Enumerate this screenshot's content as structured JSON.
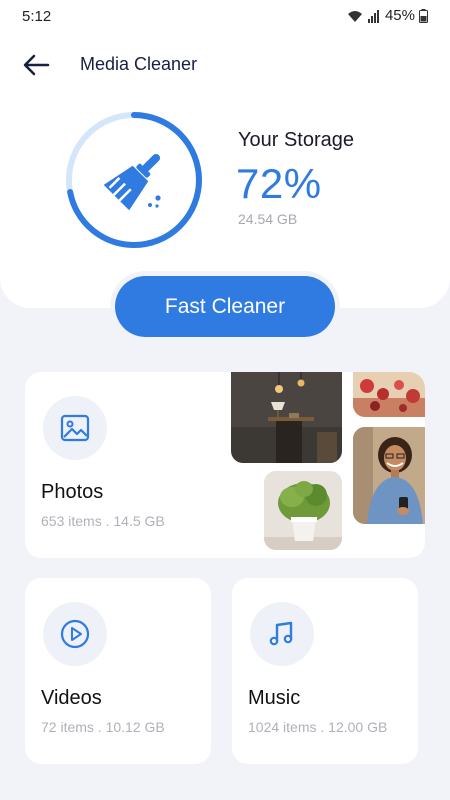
{
  "status_bar": {
    "time": "5:12",
    "battery": "45%",
    "icons": [
      "wifi-icon",
      "signal-icon",
      "battery-icon"
    ]
  },
  "header": {
    "title": "Media Cleaner",
    "back_icon": "arrow-left-icon"
  },
  "storage": {
    "label": "Your Storage",
    "percent_text": "72%",
    "percent_value": 72,
    "size": "24.54 GB",
    "icon": "broom-icon"
  },
  "fast_cleaner": {
    "label": "Fast Cleaner"
  },
  "photos": {
    "title": "Photos",
    "subtitle": "653 items . 14.5 GB",
    "icon": "image-icon",
    "thumbnails": [
      "interior-lamp-photo",
      "flowers-photo",
      "plant-pot-photo",
      "woman-portrait-photo"
    ]
  },
  "videos": {
    "title": "Videos",
    "subtitle": "72 items . 10.12 GB",
    "icon": "play-circle-icon"
  },
  "music": {
    "title": "Music",
    "subtitle": "1024 items . 12.00 GB",
    "icon": "music-note-icon"
  },
  "colors": {
    "accent": "#2f7be1",
    "accent_light": "#d5e6fb",
    "background": "#f1f3f8",
    "card": "#ffffff",
    "muted_text": "#b0b0b8"
  }
}
